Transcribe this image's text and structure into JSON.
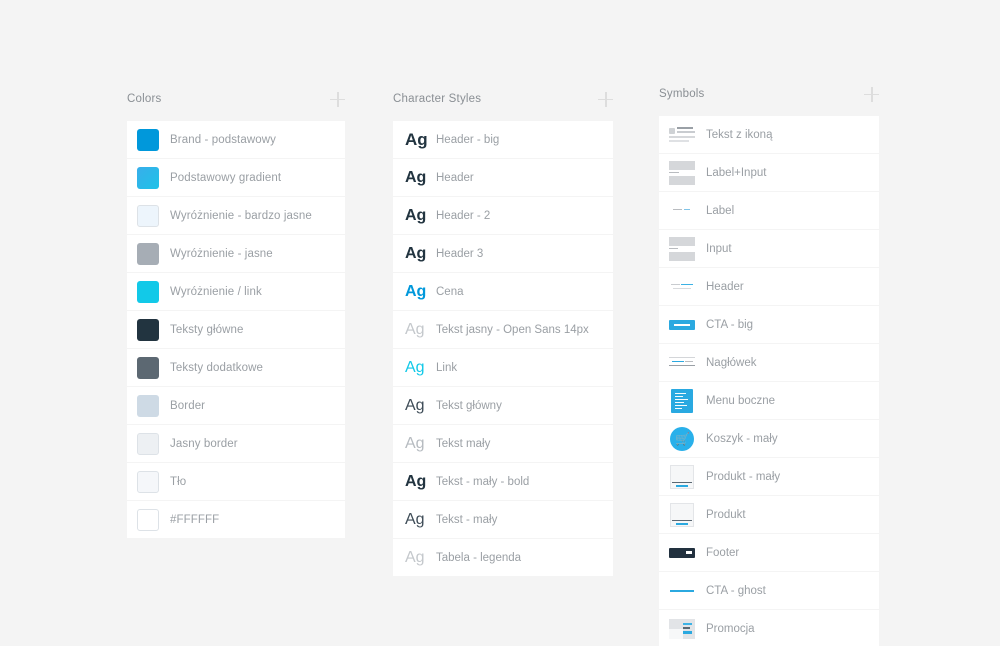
{
  "columns": {
    "colors": {
      "title": "Colors",
      "add_icon": "plus-icon",
      "items": [
        {
          "label": "Brand - podstawowy",
          "color": "#0098DB",
          "border": false
        },
        {
          "label": "Podstawowy gradient",
          "color": "linear-gradient(135deg,#38AEEA 0%,#1FC2E8 100%)",
          "border": false
        },
        {
          "label": "Wyróżnienie - bardzo jasne",
          "color": "#EDF5FC",
          "border": true
        },
        {
          "label": "Wyróżnienie - jasne",
          "color": "#A6ADB5",
          "border": false
        },
        {
          "label": "Wyróżnienie / link",
          "color": "#12C9E8",
          "border": false
        },
        {
          "label": "Teksty główne",
          "color": "#223440",
          "border": false
        },
        {
          "label": "Teksty dodatkowe",
          "color": "#5C6872",
          "border": false
        },
        {
          "label": "Border",
          "color": "#CEDAE5",
          "border": false
        },
        {
          "label": "Jasny border",
          "color": "#EDF0F3",
          "border": true
        },
        {
          "label": "Tło",
          "color": "#F5F7FA",
          "border": true
        },
        {
          "label": "#FFFFFF",
          "color": "#FFFFFF",
          "border": true
        }
      ]
    },
    "character_styles": {
      "title": "Character Styles",
      "add_icon": "plus-icon",
      "sample": "Ag",
      "items": [
        {
          "label": "Header - big",
          "color": "#223440",
          "weight": "bold",
          "size": 17
        },
        {
          "label": "Header",
          "color": "#223440",
          "weight": "bold",
          "size": 16
        },
        {
          "label": "Header - 2",
          "color": "#223440",
          "weight": "bold",
          "size": 16
        },
        {
          "label": "Header 3",
          "color": "#223440",
          "weight": "bold",
          "size": 16
        },
        {
          "label": "Cena",
          "color": "#0098DB",
          "weight": "bold",
          "size": 16
        },
        {
          "label": "Tekst jasny - Open Sans  14px",
          "color": "#C4C8CC",
          "weight": "normal",
          "size": 16
        },
        {
          "label": "Link",
          "color": "#12C9E8",
          "weight": "normal",
          "size": 16
        },
        {
          "label": "Tekst główny",
          "color": "#3E4C57",
          "weight": "normal",
          "size": 16
        },
        {
          "label": "Tekst mały",
          "color": "#B6BBC0",
          "weight": "normal",
          "size": 16
        },
        {
          "label": "Tekst - mały - bold",
          "color": "#223440",
          "weight": "bold",
          "size": 16
        },
        {
          "label": "Tekst - mały",
          "color": "#3E4C57",
          "weight": "normal",
          "size": 16
        },
        {
          "label": "Tabela - legenda",
          "color": "#C4C8CC",
          "weight": "normal",
          "size": 16
        }
      ]
    },
    "symbols": {
      "title": "Symbols",
      "add_icon": "plus-icon",
      "items": [
        {
          "label": "Tekst z ikoną",
          "thumb": "text-with-icon-thumbnail"
        },
        {
          "label": "Label+Input",
          "thumb": "label-input-thumbnail"
        },
        {
          "label": "Label",
          "thumb": "label-thumbnail"
        },
        {
          "label": "Input",
          "thumb": "input-thumbnail"
        },
        {
          "label": "Header",
          "thumb": "header-thumbnail"
        },
        {
          "label": "CTA - big",
          "thumb": "cta-big-thumbnail"
        },
        {
          "label": "Nagłówek",
          "thumb": "naglowek-thumbnail"
        },
        {
          "label": "Menu boczne",
          "thumb": "side-menu-thumbnail"
        },
        {
          "label": "Koszyk - mały",
          "thumb": "cart-small-thumbnail"
        },
        {
          "label": "Produkt - mały",
          "thumb": "product-small-thumbnail"
        },
        {
          "label": "Produkt",
          "thumb": "product-thumbnail"
        },
        {
          "label": "Footer",
          "thumb": "footer-thumbnail"
        },
        {
          "label": "CTA - ghost",
          "thumb": "cta-ghost-thumbnail"
        },
        {
          "label": "Promocja",
          "thumb": "promocja-thumbnail"
        }
      ]
    }
  },
  "theme": {
    "background": "#F4F4F4",
    "card": "#FFFFFF",
    "label_text": "#9A9FA4",
    "title_text": "#8A8F94",
    "accent": "#0098DB"
  }
}
